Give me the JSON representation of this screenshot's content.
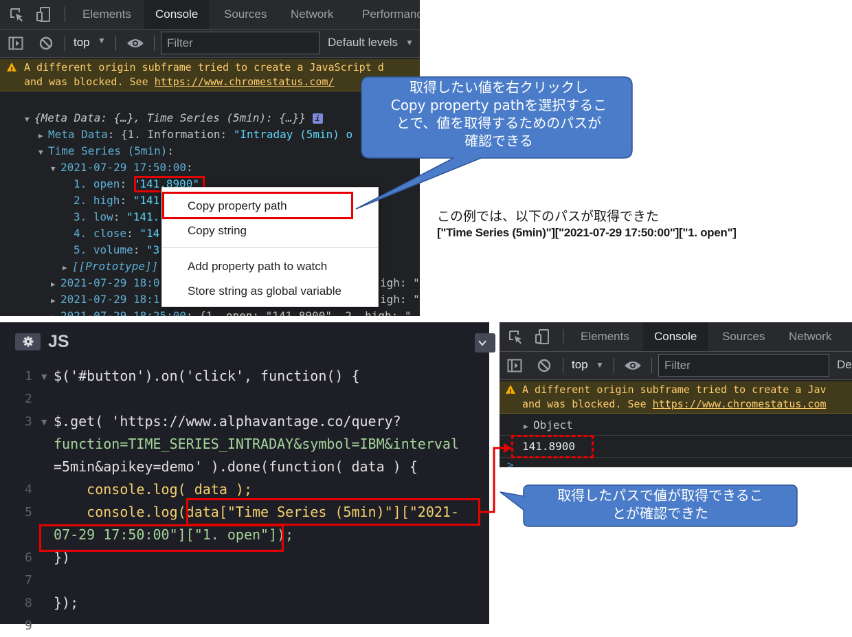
{
  "devtools_top": {
    "tabs": [
      "Elements",
      "Console",
      "Sources",
      "Network",
      "Performanc"
    ],
    "active_tab": "Console",
    "context": "top",
    "filter_placeholder": "Filter",
    "levels": "Default levels",
    "warning_line1": "A different origin subframe tried to create a JavaScript d",
    "warning_line2_prefix": "and was blocked. See ",
    "warning_link": "https://www.chromestatus.com/",
    "tree": {
      "root": "{Meta Data: {…}, Time Series (5min): {…}}",
      "info_badge": "i",
      "meta_key": "Meta Data",
      "meta_value": "{1. Information: ",
      "meta_value_str": "\"Intraday (5min) o",
      "series_key": "Time Series (5min)",
      "date_key": "2021-07-29 17:50:00",
      "fields": [
        {
          "key": "1. open",
          "value": "\"141.8900\""
        },
        {
          "key": "2. high",
          "value": "\"141"
        },
        {
          "key": "3. low",
          "value": "\"141."
        },
        {
          "key": "4. close",
          "value": "\"14"
        },
        {
          "key": "5. volume",
          "value": "\"3"
        }
      ],
      "prototype": "[[Prototype]]",
      "more_rows": [
        {
          "key": "2021-07-29 18:0",
          "tail": "igh: \""
        },
        {
          "key": "2021-07-29 18:1",
          "tail": "igh: \""
        },
        {
          "key": "2021-07-29 18:25:00",
          "tail": ": {1. open: \"141.8900\", 2. high: \""
        }
      ]
    },
    "context_menu": [
      "Copy property path",
      "Copy string",
      "Add property path to watch",
      "Store string as global variable"
    ]
  },
  "callout_top": {
    "text_lines": [
      "取得したい値を右クリックし",
      "Copy property pathを選択するこ",
      "とで、値を取得するためのパスが",
      "確認できる"
    ],
    "color": "#4a7cc9"
  },
  "example_note": {
    "line1": "この例では、以下のパスが取得できた",
    "line2": "[\"Time Series (5min)\"][\"2021-07-29 17:50:00\"][\"1. open\"]"
  },
  "editor": {
    "title": "JS",
    "line_numbers": [
      "1",
      "2",
      "3",
      "4",
      "5",
      "6",
      "7",
      "8"
    ],
    "code": [
      "$('#button').on('click', function() {",
      "",
      "$.get( 'https://www.alphavantage.co/query?",
      "function=TIME_SERIES_INTRADAY&symbol=IBM&interval",
      "=5min&apikey=demo' ).done(function( data ) {",
      "    console.log( data );",
      "    console.log(data[\"Time Series (5min)\"][\"2021-",
      "07-29 17:50:00\"][\"1. open\"]);",
      "})",
      "",
      "});"
    ]
  },
  "devtools_bottom": {
    "tabs": [
      "Elements",
      "Console",
      "Sources",
      "Network"
    ],
    "active_tab": "Console",
    "context": "top",
    "filter_placeholder": "Filter",
    "levels_fragment": "De",
    "warning_line1": "A different origin subframe tried to create a Jav",
    "warning_line2_prefix": "and was blocked. See ",
    "warning_link": "https://www.chromestatus.com",
    "object_label": "Object",
    "value": "141.8900",
    "prompt": ">"
  },
  "callout_bottom": {
    "text_lines": [
      "取得したパスで値が取得できるこ",
      "とが確認できた"
    ],
    "color": "#4a7cc9"
  },
  "colors": {
    "highlight": "#e60000",
    "devtools_bg": "#202124",
    "editor_bg": "#1e1f26"
  }
}
